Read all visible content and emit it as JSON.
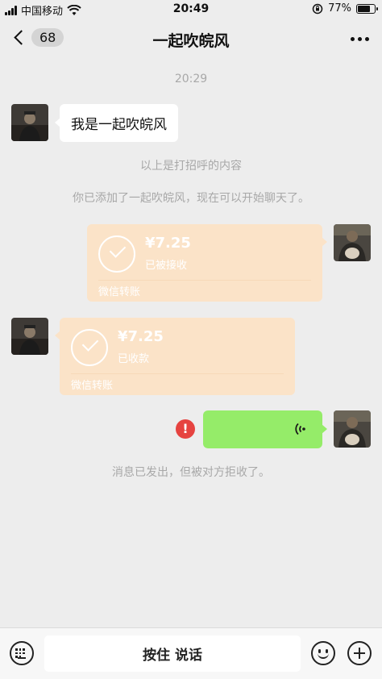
{
  "status_bar": {
    "carrier": "中国移动",
    "time": "20:49",
    "battery_text": "77%",
    "battery_level": 0.77
  },
  "nav": {
    "unread_count": "68",
    "title": "一起吹皖风"
  },
  "chat": {
    "timestamp": "20:29",
    "greeting_message": "我是一起吹皖风",
    "system_greeting_note": "以上是打招呼的内容",
    "system_added_note": "你已添加了一起吹皖风，现在可以开始聊天了。",
    "transfer_sent": {
      "amount": "¥7.25",
      "status": "已被接收",
      "label": "微信转账"
    },
    "transfer_received": {
      "amount": "¥7.25",
      "status": "已收款",
      "label": "微信转账"
    },
    "error_mark": "!",
    "rejected_note": "消息已发出，但被对方拒收了。"
  },
  "input_bar": {
    "hold_to_talk": "按住 说话"
  },
  "colors": {
    "background": "#ededed",
    "transfer_bubble": "#fbe3c8",
    "voice_bubble": "#95ec69",
    "error": "#e64340"
  },
  "icons": [
    "signal-icon",
    "wifi-icon",
    "orientation-lock-icon",
    "battery-icon",
    "back-chevron-icon",
    "more-icon",
    "check-icon",
    "voice-wave-icon",
    "error-icon",
    "keyboard-icon",
    "emoji-icon",
    "plus-icon"
  ]
}
